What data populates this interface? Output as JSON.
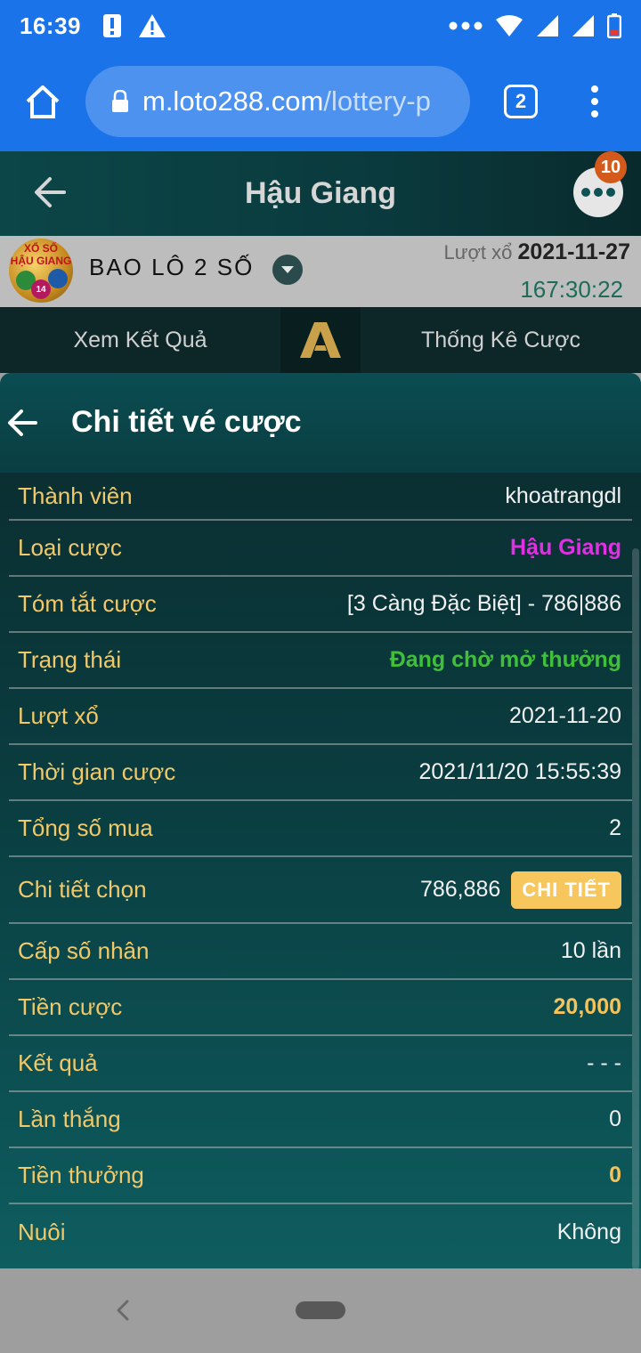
{
  "status_bar": {
    "time": "16:39"
  },
  "browser": {
    "url_host": "m.loto288.com",
    "url_path": "/lottery-p",
    "tab_count": "2"
  },
  "app_header": {
    "title": "Hậu Giang",
    "chat_badge": "10"
  },
  "game": {
    "logo_line1": "XỔ SỐ",
    "logo_line2": "HẬU GIANG",
    "logo_ball_number": "14",
    "name": "BAO LÔ 2 SỐ",
    "draw_label": "Lượt xổ",
    "draw_date": "2021-11-27",
    "countdown": "167:30:22"
  },
  "tabs": {
    "results": "Xem Kết Quả",
    "logo_letter": "A",
    "bet_stats": "Thống Kê Cược"
  },
  "dialog": {
    "title": "Chi tiết vé cược",
    "rows": [
      {
        "label": "Thành viên",
        "value": "khoatrangdl"
      },
      {
        "label": "Loại cược",
        "value": "Hậu Giang"
      },
      {
        "label": "Tóm tắt cược",
        "value": "[3 Càng Đặc Biệt] - 786|886"
      },
      {
        "label": "Trạng thái",
        "value": "Đang chờ mở thưởng"
      },
      {
        "label": "Lượt xổ",
        "value": "2021-11-20"
      },
      {
        "label": "Thời gian cược",
        "value": "2021/11/20 15:55:39"
      },
      {
        "label": "Tổng số mua",
        "value": "2"
      },
      {
        "label": "Chi tiết chọn",
        "value": "786,886",
        "button": "CHI TIẾT"
      },
      {
        "label": "Cấp số nhân",
        "value": "10 lần"
      },
      {
        "label": "Tiền cược",
        "value": "20,000"
      },
      {
        "label": "Kết quả",
        "value": "- - -"
      },
      {
        "label": "Lần thắng",
        "value": "0"
      },
      {
        "label": "Tiền thưởng",
        "value": "0"
      },
      {
        "label": "Nuôi",
        "value": "Không"
      }
    ]
  },
  "colors": {
    "browser_blue": "#1a73e8",
    "label_gold": "#f1c96a",
    "value_pink": "#e12fe3",
    "value_green": "#3fbf3a",
    "value_gold": "#f5c35b",
    "detail_button": "#f7c75e"
  }
}
